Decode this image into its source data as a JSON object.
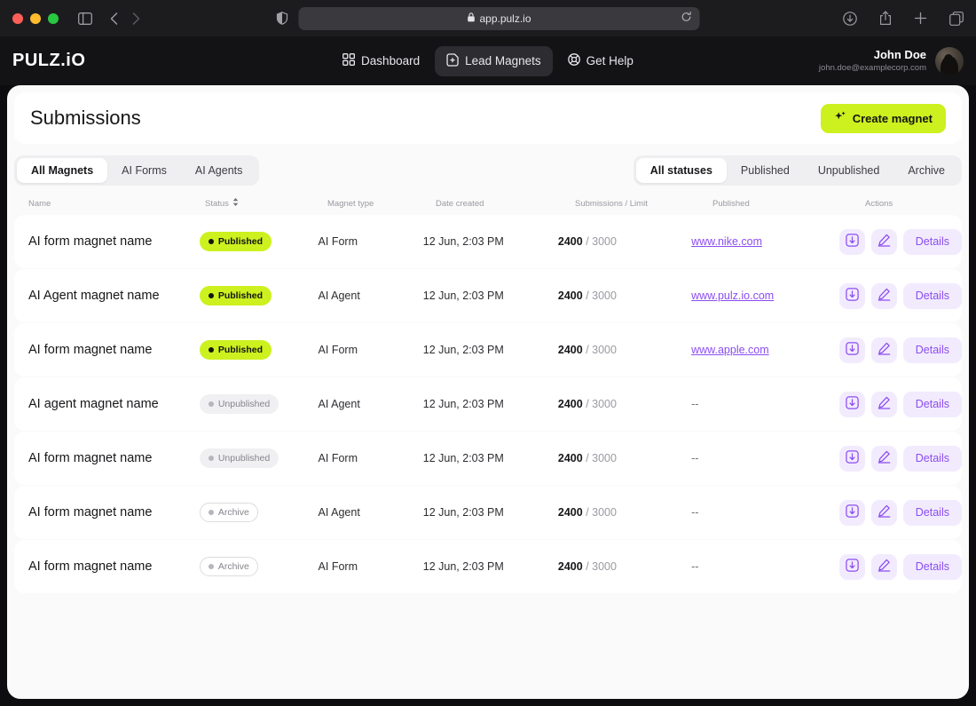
{
  "browser": {
    "url": "app.pulz.io",
    "lock_icon": "lock-icon",
    "shield_icon": "shield-icon",
    "reload_icon": "reload-icon",
    "sidebar_icon": "sidebar-toggle-icon",
    "back_icon": "back-arrow-icon",
    "forward_icon": "forward-arrow-icon",
    "download_icon": "download-icon",
    "share_icon": "share-icon",
    "newtab_icon": "plus-icon",
    "tabs_icon": "tabs-overview-icon"
  },
  "header": {
    "logo": "PULZ.iO",
    "nav": [
      {
        "label": "Dashboard",
        "icon": "grid-icon",
        "active": false
      },
      {
        "label": "Lead Magnets",
        "icon": "file-plus-icon",
        "active": true
      },
      {
        "label": "Get Help",
        "icon": "lifebuoy-icon",
        "active": false
      }
    ],
    "user": {
      "name": "John Doe",
      "email": "john.doe@examplecorp.com",
      "avatar": "user-avatar"
    }
  },
  "page": {
    "title": "Submissions",
    "create_button": "Create magnet",
    "create_icon": "sparkle-icon"
  },
  "filters": {
    "magnet_tabs": [
      {
        "label": "All Magnets",
        "active": true
      },
      {
        "label": "AI Forms",
        "active": false
      },
      {
        "label": "AI Agents",
        "active": false
      }
    ],
    "status_tabs": [
      {
        "label": "All statuses",
        "active": true
      },
      {
        "label": "Published",
        "active": false
      },
      {
        "label": "Unpublished",
        "active": false
      },
      {
        "label": "Archive",
        "active": false
      }
    ]
  },
  "table": {
    "columns": [
      {
        "label": "Name",
        "sortable": false
      },
      {
        "label": "Status",
        "sortable": true,
        "sort_icon": "sort-icon"
      },
      {
        "label": "Magnet type",
        "sortable": false
      },
      {
        "label": "Date created",
        "sortable": false
      },
      {
        "label": "Submissions / Limit",
        "sortable": false
      },
      {
        "label": "Published",
        "sortable": false
      },
      {
        "label": "Actions",
        "sortable": false
      }
    ],
    "action_labels": {
      "download": "download-icon",
      "edit": "edit-pencil-icon",
      "details": "Details"
    },
    "rows": [
      {
        "name": "AI form magnet name",
        "status": "Published",
        "status_kind": "published",
        "type": "AI Form",
        "date": "12 Jun, 2:03 PM",
        "submissions": "2400",
        "limit": "/ 3000",
        "published_url": "www.nike.com"
      },
      {
        "name": "AI Agent magnet name",
        "status": "Published",
        "status_kind": "published",
        "type": "AI Agent",
        "date": "12 Jun, 2:03 PM",
        "submissions": "2400",
        "limit": "/ 3000",
        "published_url": "www.pulz.io.com"
      },
      {
        "name": "AI form magnet name",
        "status": "Published",
        "status_kind": "published",
        "type": "AI Form",
        "date": "12 Jun, 2:03 PM",
        "submissions": "2400",
        "limit": "/ 3000",
        "published_url": "www.apple.com"
      },
      {
        "name": "AI agent magnet name",
        "status": "Unpublished",
        "status_kind": "unpublished",
        "type": "AI Agent",
        "date": "12 Jun, 2:03 PM",
        "submissions": "2400",
        "limit": "/ 3000",
        "published_url": "--"
      },
      {
        "name": "AI form magnet name",
        "status": "Unpublished",
        "status_kind": "unpublished",
        "type": "AI Form",
        "date": "12 Jun, 2:03 PM",
        "submissions": "2400",
        "limit": "/ 3000",
        "published_url": "--"
      },
      {
        "name": "AI form magnet name",
        "status": "Archive",
        "status_kind": "archive",
        "type": "AI Agent",
        "date": "12 Jun, 2:03 PM",
        "submissions": "2400",
        "limit": "/ 3000",
        "published_url": "--"
      },
      {
        "name": "AI form magnet name",
        "status": "Archive",
        "status_kind": "archive",
        "type": "AI Form",
        "date": "12 Jun, 2:03 PM",
        "submissions": "2400",
        "limit": "/ 3000",
        "published_url": "--"
      }
    ]
  },
  "colors": {
    "accent_lime": "#ccf11f",
    "accent_purple": "#8b4df0",
    "purple_soft": "#f2ebfe",
    "chrome_dark": "#1c1c1f",
    "header_dark": "#131316"
  }
}
